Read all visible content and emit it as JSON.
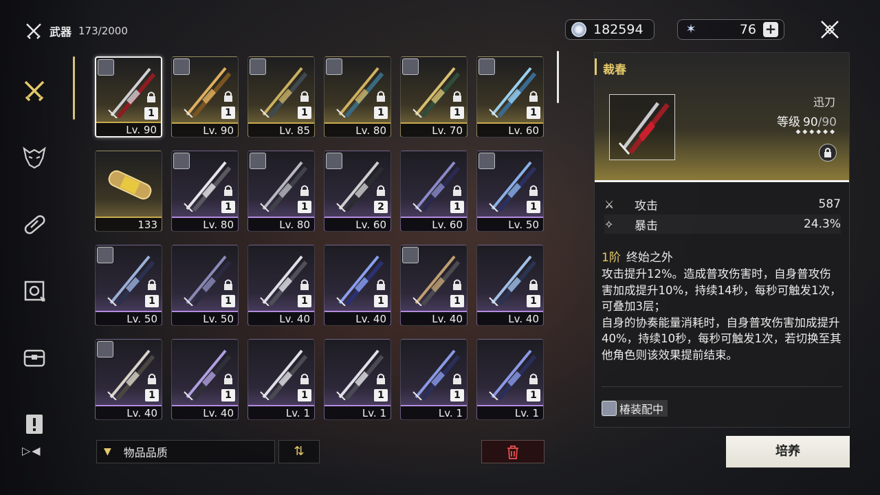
{
  "header": {
    "title": "武器",
    "count": "173/2000"
  },
  "currencies": {
    "coins": "182594",
    "stars": "76"
  },
  "sidebar": {
    "items": [
      {
        "name": "weapons",
        "icon": "crossed-swords-icon"
      },
      {
        "name": "echoes",
        "icon": "demon-mask-icon"
      },
      {
        "name": "materials",
        "icon": "capsule-icon"
      },
      {
        "name": "development",
        "icon": "gear-cube-icon"
      },
      {
        "name": "resources",
        "icon": "chest-icon"
      },
      {
        "name": "quest-items",
        "icon": "alert-box-icon"
      }
    ]
  },
  "weapons": [
    {
      "level": "Lv. 90",
      "rank": "1",
      "rarity": "gold",
      "avatar": true,
      "selected": true
    },
    {
      "level": "Lv. 90",
      "rank": "1",
      "rarity": "gold",
      "avatar": true
    },
    {
      "level": "Lv. 85",
      "rank": "1",
      "rarity": "gold",
      "avatar": true
    },
    {
      "level": "Lv. 80",
      "rank": "1",
      "rarity": "gold",
      "avatar": true
    },
    {
      "level": "Lv. 70",
      "rank": "1",
      "rarity": "gold",
      "avatar": true
    },
    {
      "level": "Lv. 60",
      "rank": "1",
      "rarity": "gold",
      "avatar": true
    },
    {
      "level": "133",
      "rank": "",
      "rarity": "gold",
      "avatar": false,
      "item": "capsule"
    },
    {
      "level": "Lv. 80",
      "rank": "1",
      "rarity": "purple",
      "avatar": true
    },
    {
      "level": "Lv. 80",
      "rank": "1",
      "rarity": "purple",
      "avatar": true
    },
    {
      "level": "Lv. 60",
      "rank": "2",
      "rarity": "purple",
      "avatar": true
    },
    {
      "level": "Lv. 60",
      "rank": "1",
      "rarity": "purple",
      "avatar": false
    },
    {
      "level": "Lv. 50",
      "rank": "1",
      "rarity": "purple",
      "avatar": true
    },
    {
      "level": "Lv. 50",
      "rank": "1",
      "rarity": "purple",
      "avatar": true
    },
    {
      "level": "Lv. 50",
      "rank": "1",
      "rarity": "purple",
      "avatar": false
    },
    {
      "level": "Lv. 40",
      "rank": "1",
      "rarity": "purple",
      "avatar": false
    },
    {
      "level": "Lv. 40",
      "rank": "1",
      "rarity": "purple",
      "avatar": false
    },
    {
      "level": "Lv. 40",
      "rank": "1",
      "rarity": "purple",
      "avatar": true
    },
    {
      "level": "Lv. 40",
      "rank": "1",
      "rarity": "purple",
      "avatar": false
    },
    {
      "level": "Lv. 40",
      "rank": "1",
      "rarity": "purple",
      "avatar": true
    },
    {
      "level": "Lv. 40",
      "rank": "1",
      "rarity": "purple",
      "avatar": false
    },
    {
      "level": "Lv. 1",
      "rank": "1",
      "rarity": "purple",
      "avatar": false
    },
    {
      "level": "Lv. 1",
      "rank": "1",
      "rarity": "purple",
      "avatar": false
    },
    {
      "level": "Lv. 1",
      "rank": "1",
      "rarity": "purple",
      "avatar": false
    },
    {
      "level": "Lv. 1",
      "rank": "1",
      "rarity": "purple",
      "avatar": false
    }
  ],
  "controls": {
    "sort_label": "物品品质"
  },
  "detail": {
    "name": "裁春",
    "type": "迅刀",
    "level_label": "等级",
    "level": "90",
    "level_max": "/90",
    "stars": "◆◆◆◆◆◆",
    "stats": [
      {
        "name": "攻击",
        "value": "587"
      },
      {
        "name": "暴击",
        "value": "24.3%"
      }
    ],
    "effect_rank": "1阶",
    "effect_name": "终始之外",
    "effect_text": "攻击提升12%。造成普攻伤害时，自身普攻伤害加成提升10%，持续14秒，每秒可触发1次，可叠加3层；\n自身的协奏能量消耗时，自身普攻伤害加成提升40%，持续10秒，每秒可触发1次，若切换至其他角色则该效果提前结束。",
    "equipped_label": "椿装配中",
    "action_label": "培养"
  },
  "colors": {
    "accent": "#e5c96a",
    "gold": "#c7ab4c",
    "purple": "#b58be0",
    "danger": "#d84a4a"
  }
}
